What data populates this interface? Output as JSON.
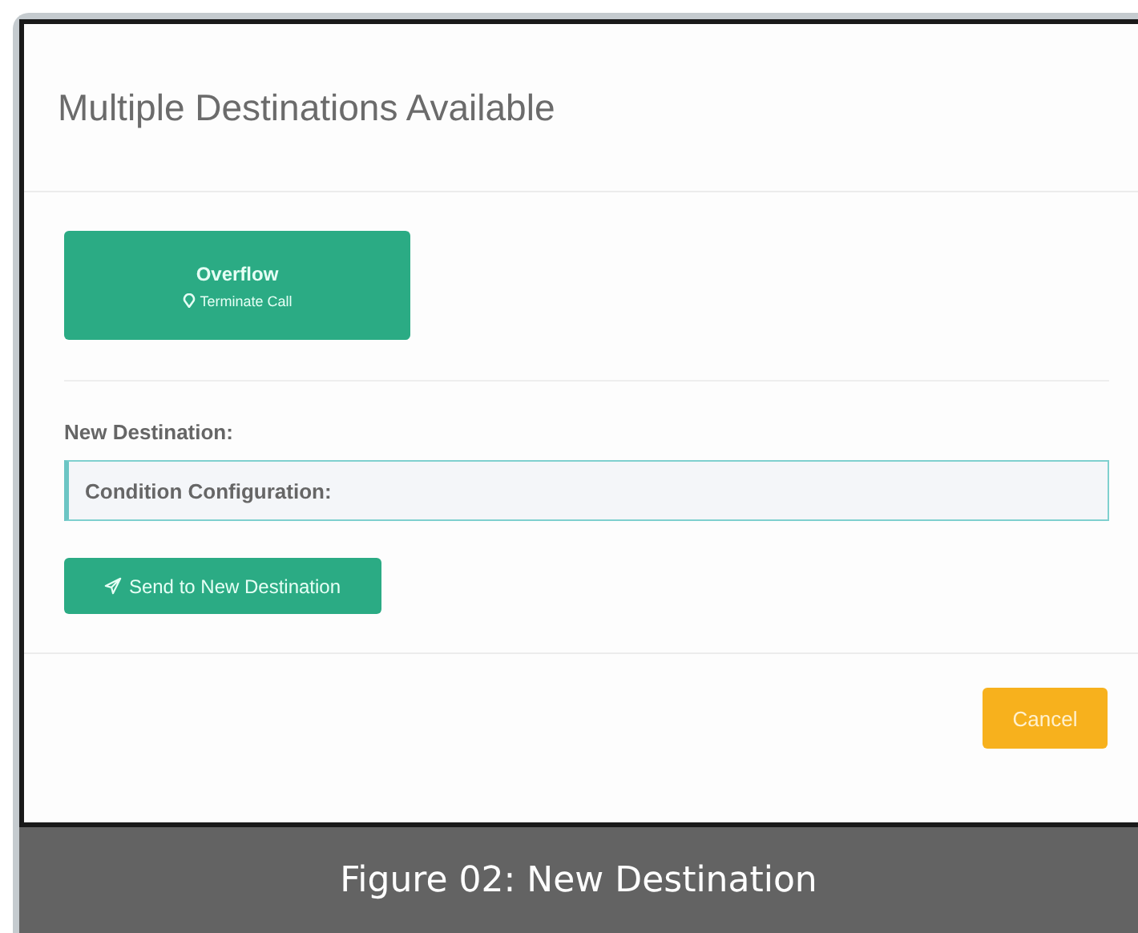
{
  "dialog": {
    "title": "Multiple Destinations Available",
    "destinations": [
      {
        "name": "Overflow",
        "action": "Terminate Call"
      }
    ],
    "field": {
      "label": "New Destination:",
      "value": "Condition Configuration:"
    },
    "send_button": "Send to New Destination",
    "cancel_button": "Cancel"
  },
  "caption": "Figure 02: New Destination"
}
